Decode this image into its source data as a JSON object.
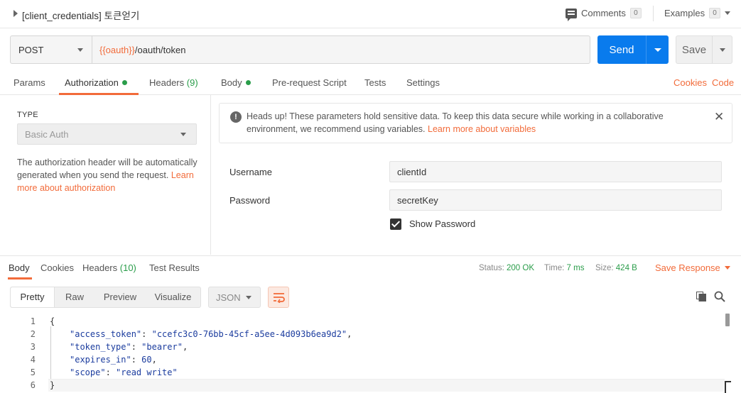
{
  "topbar": {
    "title": "[client_credentials] 토큰얻기",
    "comments_label": "Comments",
    "comments_count": "0",
    "examples_label": "Examples",
    "examples_count": "0"
  },
  "request": {
    "method": "POST",
    "url_var": "{{oauth}}",
    "url_path": "/oauth/token",
    "send_label": "Send",
    "save_label": "Save"
  },
  "req_tabs": {
    "params": "Params",
    "authorization": "Authorization",
    "headers": "Headers",
    "headers_count": "(9)",
    "body": "Body",
    "prerequest": "Pre-request Script",
    "tests": "Tests",
    "settings": "Settings",
    "cookies": "Cookies",
    "code": "Code"
  },
  "auth": {
    "type_label": "TYPE",
    "type_value": "Basic Auth",
    "desc": "The authorization header will be automatically generated when you send the request.",
    "desc_link": "Learn more about authorization"
  },
  "alert": {
    "text": "Heads up! These parameters hold sensitive data. To keep this data secure while working in a collaborative environment, we recommend using variables.",
    "link": "Learn more about variables"
  },
  "fields": {
    "username_label": "Username",
    "username_value": "clientId",
    "password_label": "Password",
    "password_value": "secretKey",
    "show_password_label": "Show Password",
    "show_password_checked": true
  },
  "response": {
    "tabs": {
      "body": "Body",
      "cookies": "Cookies",
      "headers": "Headers",
      "headers_count": "(10)",
      "test_results": "Test Results"
    },
    "status_label": "Status:",
    "status_value": "200 OK",
    "time_label": "Time:",
    "time_value": "7 ms",
    "size_label": "Size:",
    "size_value": "424 B",
    "save_response": "Save Response",
    "views": [
      "Pretty",
      "Raw",
      "Preview",
      "Visualize"
    ],
    "format": "JSON",
    "code_lines": [
      {
        "num": "1",
        "text": "{"
      },
      {
        "num": "2",
        "key": "\"access_token\"",
        "value": "\"ccefc3c0-76bb-45cf-a5ee-4d093b6ea9d2\"",
        "trail": ","
      },
      {
        "num": "3",
        "key": "\"token_type\"",
        "value": "\"bearer\"",
        "trail": ","
      },
      {
        "num": "4",
        "key": "\"expires_in\"",
        "value": "60",
        "trail": ","
      },
      {
        "num": "5",
        "key": "\"scope\"",
        "value": "\"read write\"",
        "trail": ""
      },
      {
        "num": "6",
        "text": "}"
      }
    ]
  },
  "colors": {
    "accent": "#f26b3a",
    "send_blue": "#097bed",
    "success_green": "#2a9d4a"
  }
}
